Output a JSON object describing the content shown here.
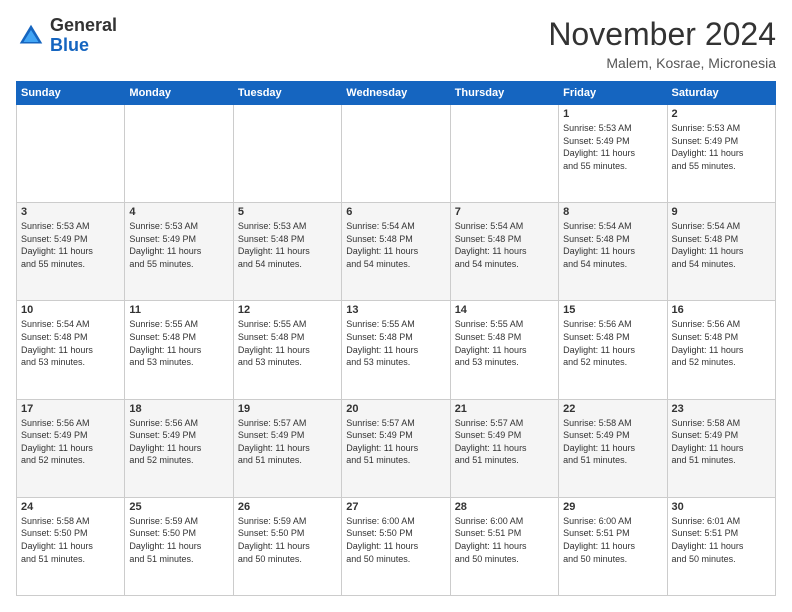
{
  "logo": {
    "line1": "General",
    "line2": "Blue"
  },
  "title": "November 2024",
  "location": "Malem, Kosrae, Micronesia",
  "header_days": [
    "Sunday",
    "Monday",
    "Tuesday",
    "Wednesday",
    "Thursday",
    "Friday",
    "Saturday"
  ],
  "weeks": [
    [
      {
        "day": "",
        "info": ""
      },
      {
        "day": "",
        "info": ""
      },
      {
        "day": "",
        "info": ""
      },
      {
        "day": "",
        "info": ""
      },
      {
        "day": "",
        "info": ""
      },
      {
        "day": "1",
        "info": "Sunrise: 5:53 AM\nSunset: 5:49 PM\nDaylight: 11 hours\nand 55 minutes."
      },
      {
        "day": "2",
        "info": "Sunrise: 5:53 AM\nSunset: 5:49 PM\nDaylight: 11 hours\nand 55 minutes."
      }
    ],
    [
      {
        "day": "3",
        "info": "Sunrise: 5:53 AM\nSunset: 5:49 PM\nDaylight: 11 hours\nand 55 minutes."
      },
      {
        "day": "4",
        "info": "Sunrise: 5:53 AM\nSunset: 5:49 PM\nDaylight: 11 hours\nand 55 minutes."
      },
      {
        "day": "5",
        "info": "Sunrise: 5:53 AM\nSunset: 5:48 PM\nDaylight: 11 hours\nand 54 minutes."
      },
      {
        "day": "6",
        "info": "Sunrise: 5:54 AM\nSunset: 5:48 PM\nDaylight: 11 hours\nand 54 minutes."
      },
      {
        "day": "7",
        "info": "Sunrise: 5:54 AM\nSunset: 5:48 PM\nDaylight: 11 hours\nand 54 minutes."
      },
      {
        "day": "8",
        "info": "Sunrise: 5:54 AM\nSunset: 5:48 PM\nDaylight: 11 hours\nand 54 minutes."
      },
      {
        "day": "9",
        "info": "Sunrise: 5:54 AM\nSunset: 5:48 PM\nDaylight: 11 hours\nand 54 minutes."
      }
    ],
    [
      {
        "day": "10",
        "info": "Sunrise: 5:54 AM\nSunset: 5:48 PM\nDaylight: 11 hours\nand 53 minutes."
      },
      {
        "day": "11",
        "info": "Sunrise: 5:55 AM\nSunset: 5:48 PM\nDaylight: 11 hours\nand 53 minutes."
      },
      {
        "day": "12",
        "info": "Sunrise: 5:55 AM\nSunset: 5:48 PM\nDaylight: 11 hours\nand 53 minutes."
      },
      {
        "day": "13",
        "info": "Sunrise: 5:55 AM\nSunset: 5:48 PM\nDaylight: 11 hours\nand 53 minutes."
      },
      {
        "day": "14",
        "info": "Sunrise: 5:55 AM\nSunset: 5:48 PM\nDaylight: 11 hours\nand 53 minutes."
      },
      {
        "day": "15",
        "info": "Sunrise: 5:56 AM\nSunset: 5:48 PM\nDaylight: 11 hours\nand 52 minutes."
      },
      {
        "day": "16",
        "info": "Sunrise: 5:56 AM\nSunset: 5:48 PM\nDaylight: 11 hours\nand 52 minutes."
      }
    ],
    [
      {
        "day": "17",
        "info": "Sunrise: 5:56 AM\nSunset: 5:49 PM\nDaylight: 11 hours\nand 52 minutes."
      },
      {
        "day": "18",
        "info": "Sunrise: 5:56 AM\nSunset: 5:49 PM\nDaylight: 11 hours\nand 52 minutes."
      },
      {
        "day": "19",
        "info": "Sunrise: 5:57 AM\nSunset: 5:49 PM\nDaylight: 11 hours\nand 51 minutes."
      },
      {
        "day": "20",
        "info": "Sunrise: 5:57 AM\nSunset: 5:49 PM\nDaylight: 11 hours\nand 51 minutes."
      },
      {
        "day": "21",
        "info": "Sunrise: 5:57 AM\nSunset: 5:49 PM\nDaylight: 11 hours\nand 51 minutes."
      },
      {
        "day": "22",
        "info": "Sunrise: 5:58 AM\nSunset: 5:49 PM\nDaylight: 11 hours\nand 51 minutes."
      },
      {
        "day": "23",
        "info": "Sunrise: 5:58 AM\nSunset: 5:49 PM\nDaylight: 11 hours\nand 51 minutes."
      }
    ],
    [
      {
        "day": "24",
        "info": "Sunrise: 5:58 AM\nSunset: 5:50 PM\nDaylight: 11 hours\nand 51 minutes."
      },
      {
        "day": "25",
        "info": "Sunrise: 5:59 AM\nSunset: 5:50 PM\nDaylight: 11 hours\nand 51 minutes."
      },
      {
        "day": "26",
        "info": "Sunrise: 5:59 AM\nSunset: 5:50 PM\nDaylight: 11 hours\nand 50 minutes."
      },
      {
        "day": "27",
        "info": "Sunrise: 6:00 AM\nSunset: 5:50 PM\nDaylight: 11 hours\nand 50 minutes."
      },
      {
        "day": "28",
        "info": "Sunrise: 6:00 AM\nSunset: 5:51 PM\nDaylight: 11 hours\nand 50 minutes."
      },
      {
        "day": "29",
        "info": "Sunrise: 6:00 AM\nSunset: 5:51 PM\nDaylight: 11 hours\nand 50 minutes."
      },
      {
        "day": "30",
        "info": "Sunrise: 6:01 AM\nSunset: 5:51 PM\nDaylight: 11 hours\nand 50 minutes."
      }
    ]
  ]
}
